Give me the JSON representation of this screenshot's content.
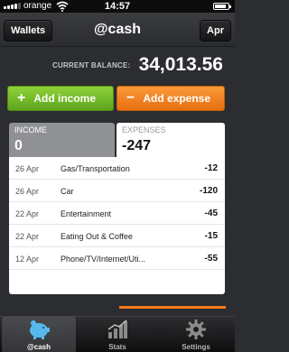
{
  "status_bar": {
    "carrier": "orange",
    "time": "14:57"
  },
  "nav": {
    "left_button": "Wallets",
    "title": "@cash",
    "right_button": "Apr"
  },
  "balance": {
    "label": "CURRENT BALANCE:",
    "value": "34,013.56"
  },
  "actions": {
    "income": {
      "symbol": "+",
      "label": "Add income",
      "color": "#7bc22e"
    },
    "expense": {
      "symbol": "−",
      "label": "Add expense",
      "color": "#f7891f"
    }
  },
  "summary": {
    "income": {
      "label": "INCOME",
      "value": "0"
    },
    "expenses": {
      "label": "EXPENSES",
      "value": "-247"
    }
  },
  "transactions": [
    {
      "date": "26 Apr",
      "category": "Gas/Transportation",
      "amount": "-12"
    },
    {
      "date": "26 Apr",
      "category": "Car",
      "amount": "-120"
    },
    {
      "date": "22 Apr",
      "category": "Entertainment",
      "amount": "-45"
    },
    {
      "date": "22 Apr",
      "category": "Eating Out & Coffee",
      "amount": "-15"
    },
    {
      "date": "12 Apr",
      "category": "Phone/TV/Internet/Uti...",
      "amount": "-55"
    }
  ],
  "tab_bar": {
    "items": [
      {
        "label": "@cash",
        "icon": "piggy-bank-icon",
        "active": true
      },
      {
        "label": "Stats",
        "icon": "bar-chart-icon",
        "active": false
      },
      {
        "label": "Settings",
        "icon": "gear-icon",
        "active": false
      }
    ]
  }
}
